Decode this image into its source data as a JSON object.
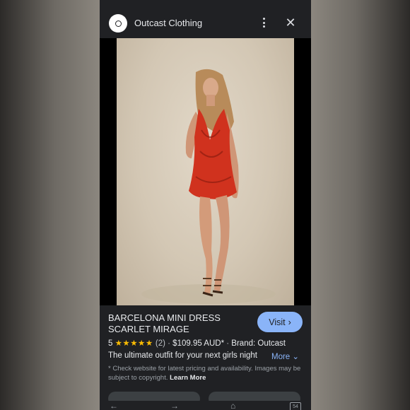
{
  "site": {
    "name": "Outcast Clothing",
    "logo_icon": "outcast-logo",
    "menu_icon": "more-vert-icon",
    "close_icon": "close-icon"
  },
  "product": {
    "title_line1": "BARCELONA MINI DRESS",
    "title_line2": "SCARLET MIRAGE",
    "rating_value": "5",
    "stars": "★★★★★",
    "review_count": "(2)",
    "price": "$109.95 AUD*",
    "brand": "Brand: Outcast",
    "description": "The ultimate outfit for your next girls night",
    "more_label": "More",
    "disclaimer": "* Check website for latest pricing and availability. Images may be subject to copyright.",
    "learn_more": "Learn More",
    "visit_label": "Visit"
  },
  "bottom_nav": {
    "tab_count": "54",
    "icons": [
      "back-icon",
      "forward-icon",
      "home-icon",
      "tabs-icon"
    ]
  },
  "colors": {
    "background": "#202124",
    "accent": "#8ab4f8",
    "star": "#fbbc04",
    "dress": "#d0321e"
  }
}
